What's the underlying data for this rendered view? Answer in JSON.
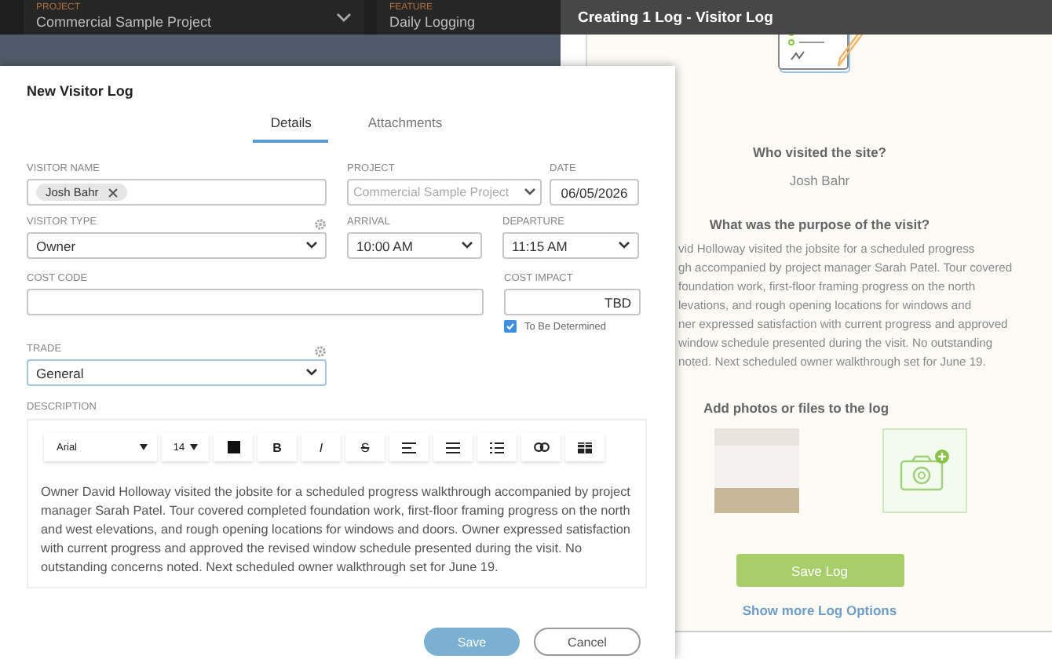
{
  "top_bar": {
    "project": {
      "label": "PROJECT",
      "value": "Commercial Sample Project"
    },
    "feature": {
      "label": "FEATURE",
      "value": "Daily Logging"
    }
  },
  "modal": {
    "title": "New Visitor Log",
    "tabs": [
      {
        "label": "Details",
        "selected": true
      },
      {
        "label": "Attachments",
        "selected": false
      }
    ],
    "visitor_name": {
      "label": "VISITOR NAME",
      "chips": [
        {
          "text": "Josh Bahr"
        }
      ]
    },
    "project": {
      "label": "PROJECT",
      "value": "Commercial Sample Project",
      "disabled": true
    },
    "date": {
      "label": "DATE",
      "value": "06/05/2026"
    },
    "visitor_type": {
      "label": "VISITOR TYPE",
      "value": "Owner"
    },
    "arrival": {
      "label": "ARRIVAL",
      "value": "10:00 AM"
    },
    "departure": {
      "label": "DEPARTURE",
      "value": "11:15 AM"
    },
    "cost_code": {
      "label": "COST CODE"
    },
    "cost_impact": {
      "label": "COST IMPACT",
      "value": "TBD",
      "checkbox": {
        "label": "To Be Determined",
        "checked": true
      }
    },
    "trade": {
      "label": "TRADE",
      "value": "General"
    },
    "description": {
      "label": "DESCRIPTION",
      "toolbar": {
        "font": "Arial",
        "size": "14",
        "buttons": [
          {
            "kind": "color"
          },
          {
            "kind": "bold",
            "label": "B"
          },
          {
            "kind": "italic",
            "label": "I"
          },
          {
            "kind": "strike",
            "label": "S"
          },
          {
            "kind": "align"
          },
          {
            "kind": "bullets"
          },
          {
            "kind": "numbered"
          },
          {
            "kind": "link"
          },
          {
            "kind": "table"
          }
        ]
      },
      "text": "Owner David Holloway visited the jobsite for a scheduled progress walkthrough accompanied by project manager Sarah Patel. Tour covered completed foundation work, first-floor framing progress on the north and west elevations, and rough opening locations for windows and doors. Owner expressed satisfaction with current progress and approved the revised window schedule presented during the visit. No outstanding concerns noted. Next scheduled owner walkthrough set for June 19."
    },
    "buttons": [
      {
        "label": "Save",
        "kind": "primary"
      },
      {
        "label": "Cancel",
        "kind": "secondary"
      }
    ]
  },
  "panel": {
    "title": "Creating 1 Log - Visitor Log",
    "who_question": "Who visited the site?",
    "who_answer": "Josh Bahr",
    "purpose_question": "What was the purpose of the visit?",
    "purpose_lines": [
      "vid Holloway visited the jobsite for a scheduled progress",
      "gh accompanied by project manager Sarah Patel. Tour covered",
      "foundation work, first-floor framing progress on the north",
      "levations, and rough opening locations for windows and",
      "ner expressed satisfaction with current progress and approved",
      "window schedule presented during the visit. No outstanding",
      "noted. Next scheduled owner walkthrough set for June 19."
    ],
    "attach_title": "Add photos or files to the log",
    "save_label": "Save Log",
    "more_link": "Show more Log Options"
  }
}
